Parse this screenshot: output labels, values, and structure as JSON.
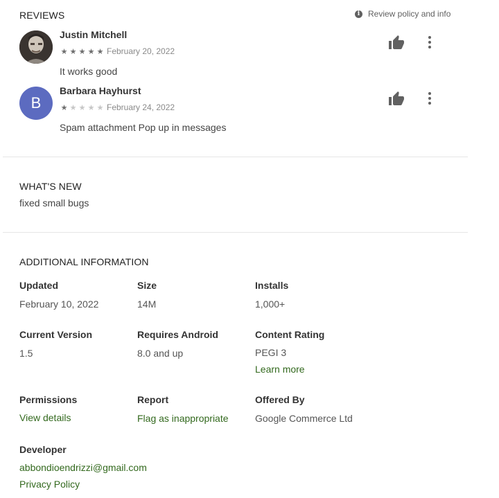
{
  "reviews": {
    "title": "REVIEWS",
    "policy_link": "Review policy and info",
    "items": [
      {
        "name": "Justin Mitchell",
        "rating": 5,
        "stars": [
          "★",
          "★",
          "★",
          "★",
          "★"
        ],
        "date": "February 20, 2022",
        "text": "It works good"
      },
      {
        "name": "Barbara Hayhurst",
        "rating": 1,
        "avatar_letter": "B",
        "stars": [
          "★",
          "★",
          "★",
          "★",
          "★"
        ],
        "date": "February 24, 2022",
        "text": "Spam attachment Pop up in messages"
      }
    ],
    "icons": {
      "helpful": "thumbs-up-icon",
      "more": "more-vert-icon",
      "info": "info-icon"
    },
    "colors": {
      "avatar_b": "#5c6bc0",
      "thumb": "#616161"
    }
  },
  "whats_new": {
    "title": "WHAT'S NEW",
    "text": "fixed small bugs"
  },
  "additional_info": {
    "title": "ADDITIONAL INFORMATION",
    "updated": {
      "label": "Updated",
      "value": "February 10, 2022"
    },
    "size": {
      "label": "Size",
      "value": "14M"
    },
    "installs": {
      "label": "Installs",
      "value": "1,000+"
    },
    "current_version": {
      "label": "Current Version",
      "value": "1.5"
    },
    "requires_android": {
      "label": "Requires Android",
      "value": "8.0 and up"
    },
    "content_rating": {
      "label": "Content Rating",
      "value": "PEGI 3",
      "link": "Learn more"
    },
    "permissions": {
      "label": "Permissions",
      "link": "View details"
    },
    "report": {
      "label": "Report",
      "link": "Flag as inappropriate"
    },
    "offered_by": {
      "label": "Offered By",
      "value": "Google Commerce Ltd"
    },
    "developer": {
      "label": "Developer",
      "email": "abbondioendrizzi@gmail.com",
      "privacy": "Privacy Policy"
    },
    "link_color": "#33691e"
  }
}
